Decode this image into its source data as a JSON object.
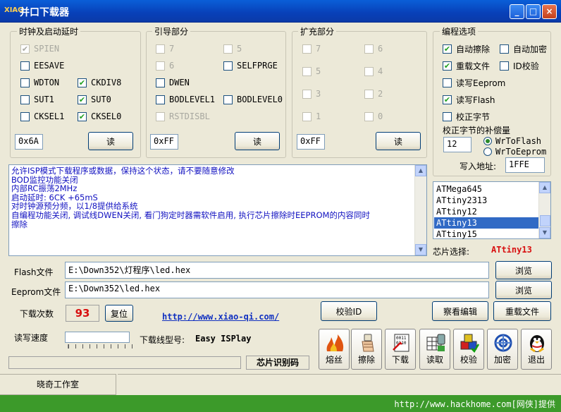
{
  "window": {
    "title": "并口下载器",
    "icon_text": "XIAO"
  },
  "clock": {
    "title": "时钟及启动延时",
    "items": [
      {
        "label": "SPIEN",
        "checked": true,
        "enabled": false
      },
      {
        "label": "EESAVE",
        "checked": false,
        "enabled": true
      },
      {
        "label": "WDTON",
        "checked": false,
        "enabled": true
      },
      {
        "label": "CKDIV8",
        "checked": true,
        "enabled": true
      },
      {
        "label": "SUT1",
        "checked": false,
        "enabled": true
      },
      {
        "label": "SUT0",
        "checked": true,
        "enabled": true
      },
      {
        "label": "CKSEL1",
        "checked": false,
        "enabled": true
      },
      {
        "label": "CKSEL0",
        "checked": true,
        "enabled": true
      }
    ],
    "value": "0x6A",
    "read_label": "读"
  },
  "boot": {
    "title": "引导部分",
    "items": [
      {
        "label": "7",
        "checked": false,
        "enabled": false
      },
      {
        "label": "5",
        "checked": false,
        "enabled": false
      },
      {
        "label": "6",
        "checked": false,
        "enabled": false
      },
      {
        "label": "SELFPRGE",
        "checked": false,
        "enabled": true
      },
      {
        "label": "DWEN",
        "checked": false,
        "enabled": true
      },
      {
        "label": "BODLEVEL1",
        "checked": false,
        "enabled": true
      },
      {
        "label": "BODLEVEL0",
        "checked": false,
        "enabled": true
      },
      {
        "label": "RSTDISBL",
        "checked": false,
        "enabled": false
      }
    ],
    "value": "0xFF",
    "read_label": "读"
  },
  "ext": {
    "title": "扩充部分",
    "items": [
      {
        "label": "7",
        "checked": false,
        "enabled": false
      },
      {
        "label": "6",
        "checked": false,
        "enabled": false
      },
      {
        "label": "5",
        "checked": false,
        "enabled": false
      },
      {
        "label": "4",
        "checked": false,
        "enabled": false
      },
      {
        "label": "3",
        "checked": false,
        "enabled": false
      },
      {
        "label": "2",
        "checked": false,
        "enabled": false
      },
      {
        "label": "1",
        "checked": false,
        "enabled": false
      },
      {
        "label": "0",
        "checked": false,
        "enabled": false
      }
    ],
    "value": "0xFF",
    "read_label": "读"
  },
  "prog": {
    "title": "编程选项",
    "items": [
      {
        "label": "自动擦除",
        "checked": true
      },
      {
        "label": "自动加密",
        "checked": false
      },
      {
        "label": "重载文件",
        "checked": true
      },
      {
        "label": "ID校验",
        "checked": false
      },
      {
        "label": "读写Eeprom",
        "checked": false
      },
      {
        "label": "读写Flash",
        "checked": true
      },
      {
        "label": "校正字节",
        "checked": false
      }
    ],
    "comp_label": "校正字节的补偿量",
    "comp_value": "12",
    "radio1": "WrToFlash",
    "radio2": "WrToEeprom",
    "selected_radio": "WrToFlash",
    "addr_label": "写入地址:",
    "addr_value": "1FFE"
  },
  "info": {
    "lines": [
      "允许ISP模式下载程序或数据，保持这个状态，请不要随意修改",
      "BOD监控功能关闭",
      "内部RC振荡2MHz",
      "启动延时: 6CK +65mS",
      "对时钟源预分频，以1/8提供给系统",
      "自编程功能关闭, 调试线DWEN关闭, 看门狗定时器需软件启用, 执行芯片擦除时EEPROM的内容同时",
      "擦除"
    ]
  },
  "chips": {
    "items": [
      "ATMega645",
      "ATtiny2313",
      "ATtiny12",
      "ATtiny13",
      "ATtiny15"
    ],
    "selected": "ATtiny13",
    "select_label": "芯片选择:",
    "selected_display": "ATtiny13"
  },
  "files": {
    "flash_label": "Flash文件",
    "flash_path": "E:\\Down352\\灯程序\\led.hex",
    "eeprom_label": "Eeprom文件",
    "eeprom_path": "E:\\Down352\\led.hex",
    "browse_label": "浏览"
  },
  "counter": {
    "label": "下载次数",
    "value": "93",
    "reset_label": "复位"
  },
  "link": "http://www.xiao-qi.com/",
  "buttons": {
    "verify_id": "校验ID",
    "view_edit": "察看编辑",
    "reload": "重载文件"
  },
  "speed": {
    "label": "读写速度",
    "cable_label": "下载线型号:",
    "cable_value": "Easy ISPlay"
  },
  "chip_id_label": "芯片识别码",
  "tools": [
    {
      "label": "熔丝",
      "icon": "fire-icon"
    },
    {
      "label": "擦除",
      "icon": "eraser-hand-icon"
    },
    {
      "label": "下载",
      "icon": "download-binary-icon"
    },
    {
      "label": "读取",
      "icon": "read-grid-icon"
    },
    {
      "label": "校验",
      "icon": "verify-cubes-icon"
    },
    {
      "label": "加密",
      "icon": "lock-knot-icon"
    },
    {
      "label": "退出",
      "icon": "penguin-icon"
    }
  ],
  "status": {
    "left": "晓奇工作室"
  },
  "footer": {
    "text": "http://www.hackhome.com[网侠]提供"
  }
}
